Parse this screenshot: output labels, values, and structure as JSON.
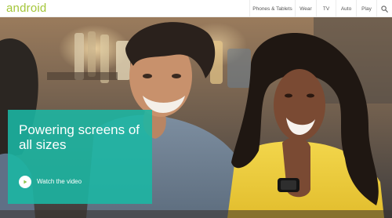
{
  "header": {
    "logo_text": "android",
    "nav": [
      {
        "label": "Phones & Tablets"
      },
      {
        "label": "Wear"
      },
      {
        "label": "TV"
      },
      {
        "label": "Auto"
      },
      {
        "label": "Play"
      }
    ],
    "search_icon": "search-icon"
  },
  "hero": {
    "headline": "Powering screens of all sizes",
    "cta_label": "Watch the video",
    "cta_icon": "play-icon"
  },
  "colors": {
    "brand_green": "#a4c639",
    "promo_teal": "#1ab7a4"
  }
}
